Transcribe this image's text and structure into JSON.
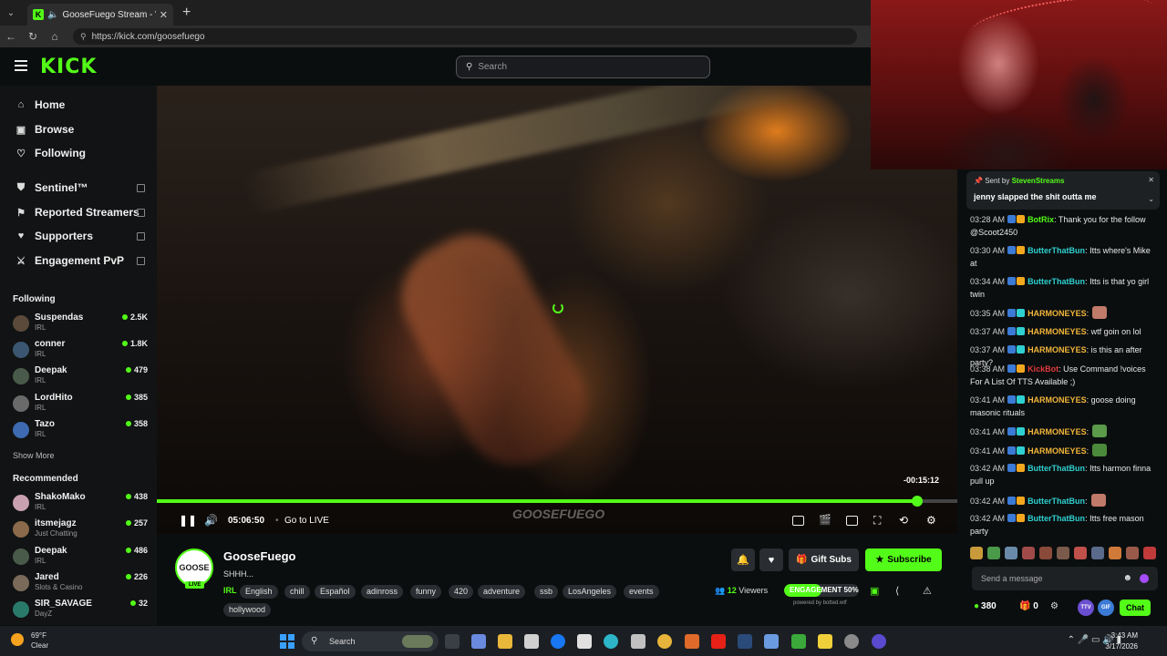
{
  "browser": {
    "tab_title": "GooseFuego Stream - Watch",
    "url": "https://kick.com/goosefuego"
  },
  "header": {
    "logo": "KICK",
    "search_placeholder": "Search"
  },
  "sidebar": {
    "nav": [
      {
        "label": "Home",
        "icon": "home-icon"
      },
      {
        "label": "Browse",
        "icon": "browse-icon"
      },
      {
        "label": "Following",
        "icon": "heart-icon"
      }
    ],
    "tools": [
      {
        "label": "Sentinel™",
        "icon": "shield-icon"
      },
      {
        "label": "Reported Streamers",
        "icon": "flag-icon"
      },
      {
        "label": "Supporters",
        "icon": "heart-icon"
      },
      {
        "label": "Engagement PvP",
        "icon": "pvp-icon"
      }
    ],
    "following_label": "Following",
    "following": [
      {
        "name": "Suspendas",
        "category": "IRL",
        "viewers": "2.5K"
      },
      {
        "name": "conner",
        "category": "IRL",
        "viewers": "1.8K"
      },
      {
        "name": "Deepak",
        "category": "IRL",
        "viewers": "479"
      },
      {
        "name": "LordHito",
        "category": "IRL",
        "viewers": "385"
      },
      {
        "name": "Tazo",
        "category": "IRL",
        "viewers": "358"
      }
    ],
    "show_more": "Show More",
    "recommended_label": "Recommended",
    "recommended": [
      {
        "name": "ShakoMako",
        "category": "IRL",
        "viewers": "438"
      },
      {
        "name": "itsmejagz",
        "category": "Just Chatting",
        "viewers": "257"
      },
      {
        "name": "Deepak",
        "category": "IRL",
        "viewers": "486"
      },
      {
        "name": "Jared",
        "category": "Slots & Casino",
        "viewers": "226"
      },
      {
        "name": "SIR_SAVAGE",
        "category": "DayZ",
        "viewers": "32"
      }
    ]
  },
  "player": {
    "time_remaining": "-00:15:12",
    "elapsed": "05:06:50",
    "go_live": "Go to LIVE",
    "progress": 0.95,
    "watermark": "GOOSEFUEGO"
  },
  "stream": {
    "avatar_text": "GOOSE",
    "live_badge": "LIVE",
    "channel_name": "GooseFuego",
    "title": "SHHH...",
    "category": "IRL",
    "tags": [
      "English",
      "chill",
      "Español",
      "adinross",
      "funny",
      "420",
      "adventure",
      "ssb",
      "LosAngeles",
      "events",
      "hollywood"
    ],
    "gift_subs": "Gift Subs",
    "subscribe": "Subscribe",
    "viewers_count": "12",
    "viewers_label": "Viewers",
    "engagement_label": "ENGAGEMENT 50%",
    "engagement_value": 0.5,
    "powered_by": "powered by botted.wtf"
  },
  "chat": {
    "pinned": {
      "sent_by_label": "Sent by",
      "sender": "StevenStreams",
      "message": "jenny slapped the shit outta me"
    },
    "messages": [
      {
        "time": "03:28 AM",
        "user": "BotRix",
        "color": "#53fc18",
        "text": ": Thank you for the follow @Scoot2450"
      },
      {
        "time": "03:30 AM",
        "user": "ButterThatBun",
        "color": "#2fd0d0",
        "text": ": Itts where's Mike at"
      },
      {
        "time": "03:34 AM",
        "user": "ButterThatBun",
        "color": "#2fd0d0",
        "text": ": Itts is that yo girl twin"
      },
      {
        "time": "03:35 AM",
        "user": "HARMONEYES",
        "color": "#f2b63a",
        "text": ":"
      },
      {
        "time": "03:37 AM",
        "user": "HARMONEYES",
        "color": "#f2b63a",
        "text": ": wtf goin on lol"
      },
      {
        "time": "03:37 AM",
        "user": "HARMONEYES",
        "color": "#f2b63a",
        "text": ": is this an after party?"
      },
      {
        "time": "03:38 AM",
        "user": "KickBot",
        "color": "#e03a3a",
        "text": ": Use Command !voices For A List Of TTS Available ;)"
      },
      {
        "time": "03:41 AM",
        "user": "HARMONEYES",
        "color": "#f2b63a",
        "text": ": goose doing masonic rituals"
      },
      {
        "time": "03:41 AM",
        "user": "HARMONEYES",
        "color": "#f2b63a",
        "text": ":"
      },
      {
        "time": "03:41 AM",
        "user": "HARMONEYES",
        "color": "#f2b63a",
        "text": ":"
      },
      {
        "time": "03:42 AM",
        "user": "ButterThatBun",
        "color": "#2fd0d0",
        "text": ": Itts harmon finna pull up"
      },
      {
        "time": "03:42 AM",
        "user": "ButterThatBun",
        "color": "#2fd0d0",
        "text": ":"
      },
      {
        "time": "03:42 AM",
        "user": "ButterThatBun",
        "color": "#2fd0d0",
        "text": ": Itts free mason party"
      }
    ],
    "input_placeholder": "Send a message",
    "points": "380",
    "gifts": "0",
    "ttv_label": "TTV",
    "gif_label": "GIF",
    "send_label": "Chat"
  },
  "taskbar": {
    "temperature": "69°F",
    "condition": "Clear",
    "search": "Search",
    "time": "3:43 AM",
    "date": "3/17/2026"
  }
}
